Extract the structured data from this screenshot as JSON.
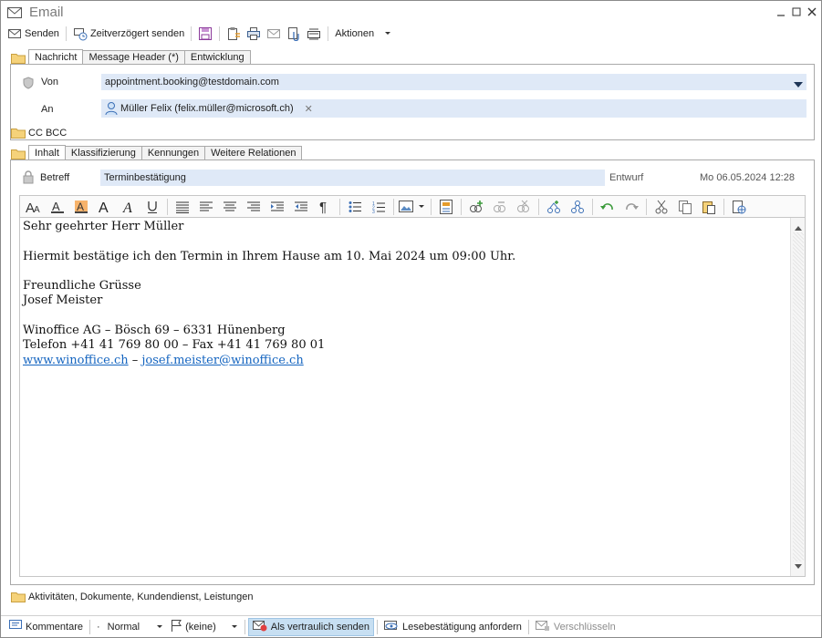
{
  "window": {
    "title": "Email"
  },
  "toolbar": {
    "send": "Senden",
    "delayed_send": "Zeitverzögert senden",
    "actions": "Aktionen"
  },
  "top_tabs": [
    "Nachricht",
    "Message Header (*)",
    "Entwicklung"
  ],
  "message": {
    "from_label": "Von",
    "from_value": "appointment.booking@testdomain.com",
    "to_label": "An",
    "to_recipient": "Müller Felix (felix.müller@microsoft.ch)",
    "cc_bcc": "CC BCC"
  },
  "content_tabs": [
    "Inhalt",
    "Klassifizierung",
    "Kennungen",
    "Weitere Relationen"
  ],
  "content": {
    "subject_label": "Betreff",
    "subject_value": "Terminbestätigung",
    "status": "Entwurf",
    "date": "Mo 06.05.2024 12:28"
  },
  "body": {
    "greeting": "Sehr geehrter Herr Müller",
    "line1": "Hiermit bestätige ich den Termin in Ihrem Hause am 10. Mai 2024 um 09:00 Uhr.",
    "closing": "Freundliche Grüsse",
    "name": "Josef Meister",
    "company": "Winoffice AG – Bösch 69 – 6331 Hünenberg",
    "phone": "Telefon +41 41 769 80 00 – Fax +41 41 769 80 01",
    "website": "www.winoffice.ch",
    "separator": " – ",
    "email": "josef.meister@winoffice.ch"
  },
  "bottom_group": "Aktivitäten, Dokumente, Kundendienst, Leistungen",
  "statusbar": {
    "comments": "Kommentare",
    "priority": "Normal",
    "flag": "(keine)",
    "confidential": "Als vertraulich senden",
    "read_receipt": "Lesebestätigung anfordern",
    "encrypt": "Verschlüsseln"
  },
  "colors": {
    "field_bg": "#dfe9f7",
    "link": "#1565c0",
    "highlight": "#c7dff2"
  }
}
